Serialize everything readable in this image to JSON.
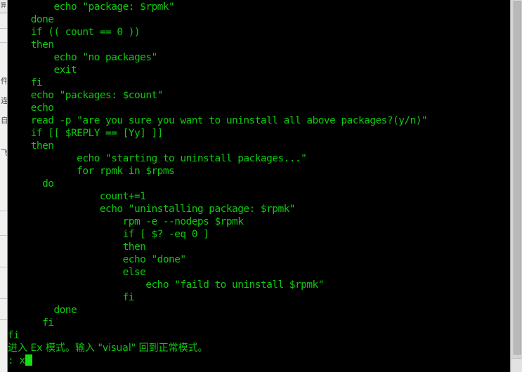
{
  "window": {
    "kind": "terminal-emulator",
    "background_color": "#000000",
    "foreground_color": "#0ec90e",
    "chrome_color": "#d4d4d4"
  },
  "background_window": {
    "visible_strip_glyphs": [
      "算",
      "件",
      "连",
      "自",
      "飞"
    ],
    "tiny_label": "算"
  },
  "terminal": {
    "lines": [
      "        echo \"package: $rpmk\"",
      "    done",
      "    if (( count == 0 ))",
      "    then",
      "        echo \"no packages\"",
      "        exit",
      "    fi",
      "    echo \"packages: $count\"",
      "    echo",
      "    read -p \"are you sure you want to uninstall all above packages?(y/n)\"",
      "    if [[ $REPLY == [Yy] ]]",
      "    then",
      "            echo \"starting to uninstall packages...\"",
      "            for rpmk in $rpms",
      "      do",
      "                count+=1",
      "                echo \"uninstalling package: $rpmk\"",
      "                    rpm -e --nodeps $rpmk",
      "                    if [ $? -eq 0 ]",
      "                    then",
      "                    echo \"done\"",
      "                    else",
      "                        echo \"faild to uninstall $rpmk\"",
      "                    fi",
      "        done",
      "      fi",
      "fi"
    ],
    "status_message": "进入 Ex 模式。输入 \"visual\" 回到正常模式。",
    "prompt_line": ": x",
    "cursor": {
      "visible": true,
      "style": "block",
      "color": "#12e012"
    }
  },
  "scrollbar": {
    "orientation": "vertical",
    "thumb_color": "#b9b9b9",
    "trough_color": "#d4d4d4"
  }
}
